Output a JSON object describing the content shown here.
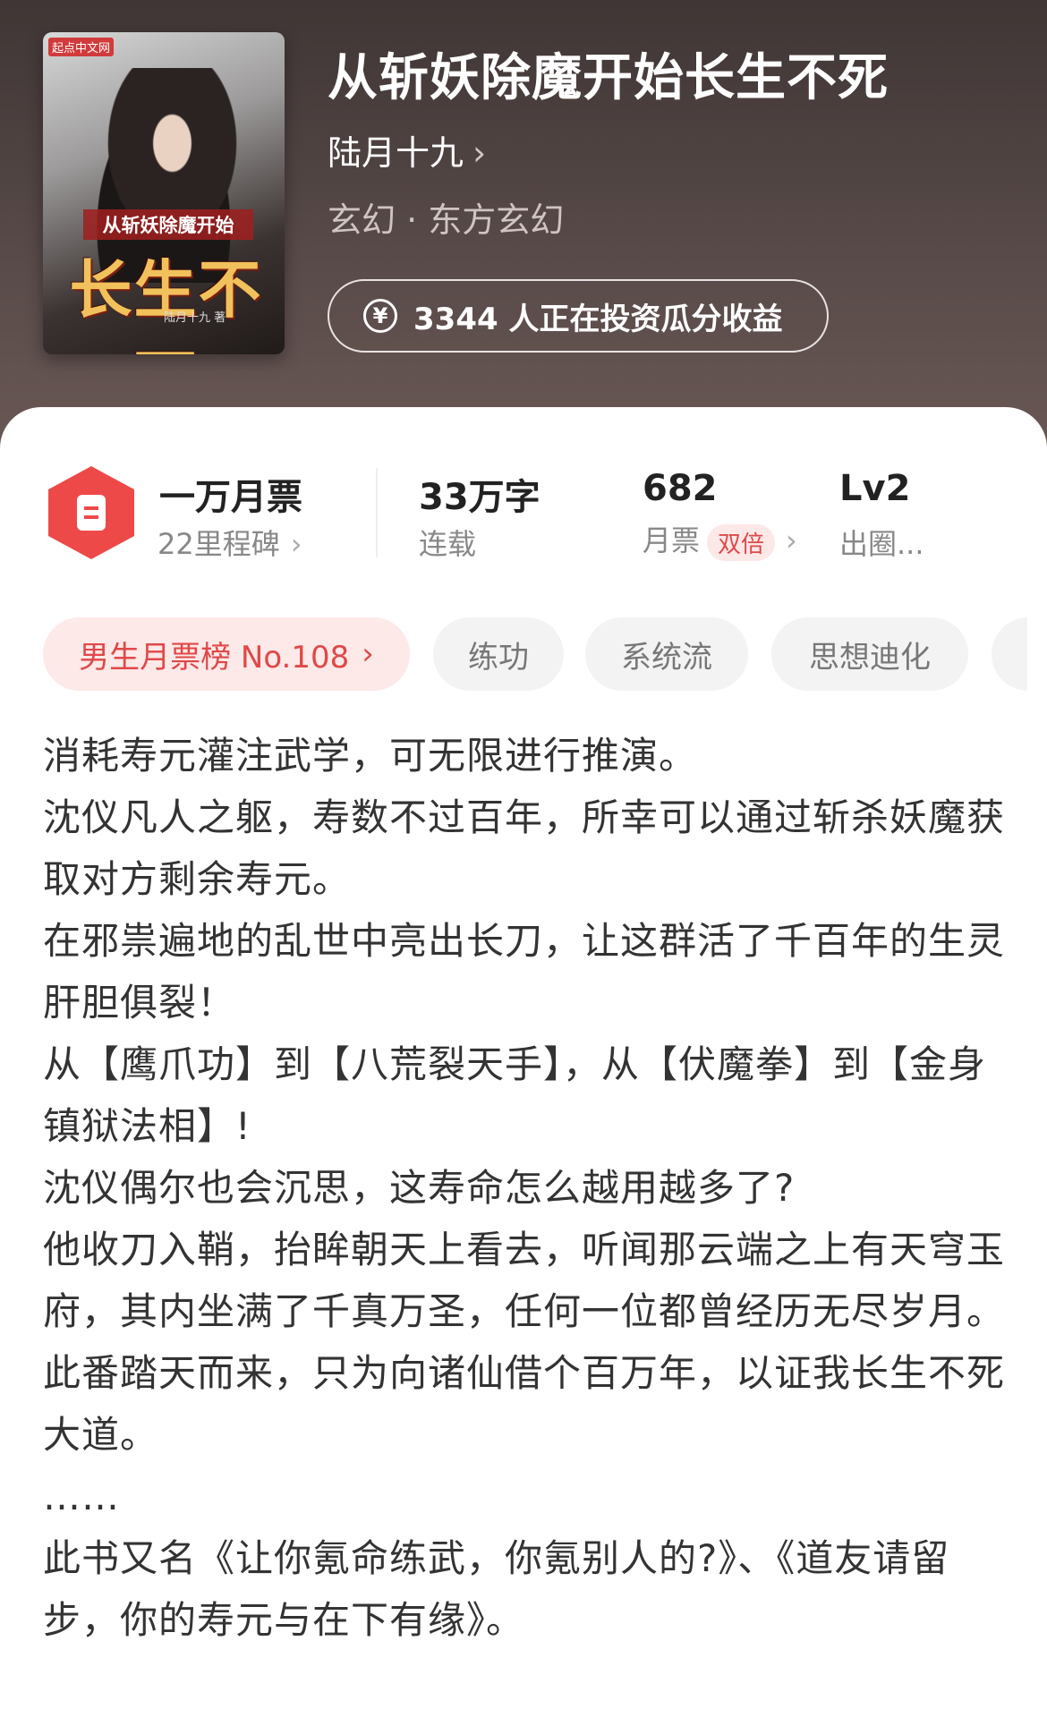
{
  "book": {
    "title": "从斩妖除魔开始长生不死",
    "author": "陆月十九",
    "genre": "玄幻 · 东方玄幻",
    "invest_label": "3344 人正在投资瓜分收益",
    "cover": {
      "badge": "起点中文网",
      "title_line1": "从斩妖除魔开始",
      "title_line2": "长生不死",
      "author_sign": "陆月十九 著"
    }
  },
  "stats": {
    "monthly_ticket": {
      "main": "一万月票",
      "sub": "22里程碑"
    },
    "words": {
      "main": "33万字",
      "sub": "连载"
    },
    "tickets": {
      "main": "682",
      "sub": "月票",
      "badge": "双倍"
    },
    "level": {
      "main": "Lv2",
      "sub": "出圈..."
    }
  },
  "tags": [
    {
      "label": "男生月票榜 No.108"
    },
    {
      "label": "练功"
    },
    {
      "label": "系统流"
    },
    {
      "label": "思想迪化"
    }
  ],
  "description": [
    "消耗寿元灌注武学，可无限进行推演。",
    "沈仪凡人之躯，寿数不过百年，所幸可以通过斩杀妖魔获取对方剩余寿元。",
    "在邪祟遍地的乱世中亮出长刀，让这群活了千百年的生灵肝胆俱裂！",
    "从【鹰爪功】到【八荒裂天手】，从【伏魔拳】到【金身镇狱法相】!",
    "沈仪偶尔也会沉思，这寿命怎么越用越多了?",
    "他收刀入鞘，抬眸朝天上看去，听闻那云端之上有天穹玉府，其内坐满了千真万圣，任何一位都曾经历无尽岁月。",
    "此番踏天而来，只为向诸仙借个百万年，以证我长生不死大道。",
    "……",
    "此书又名《让你氪命练武，你氪别人的?》、《道友请留步，你的寿元与在下有缘》。"
  ],
  "colors": {
    "header_bg": "#4a3f3e",
    "accent_red": "#ee4949",
    "tag_bg": "#f3f3f3"
  }
}
